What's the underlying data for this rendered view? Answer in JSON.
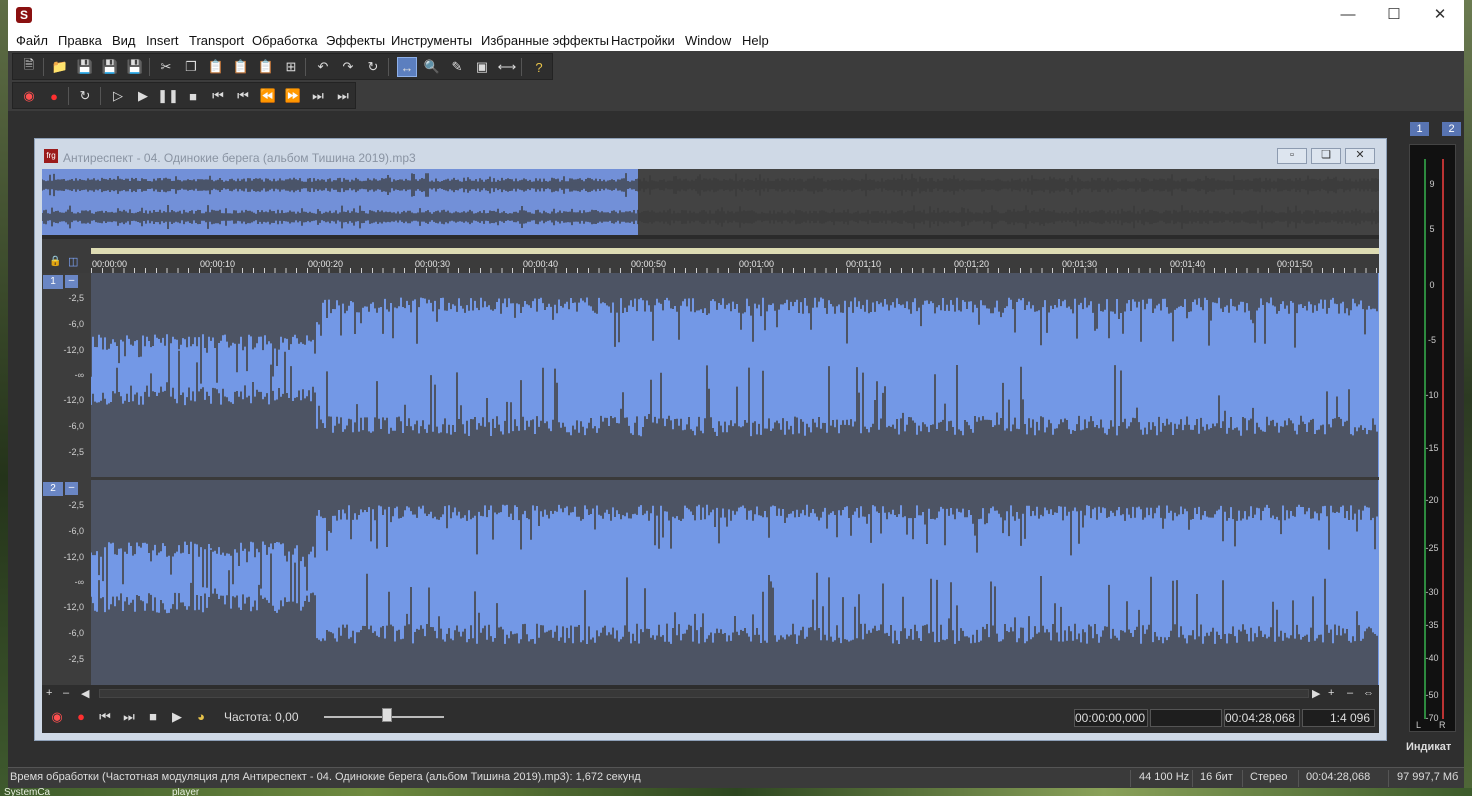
{
  "desktop": {
    "bottom_left": "SystemCa",
    "bottom_mid": "player"
  },
  "menu": [
    "Файл",
    "Правка",
    "Вид",
    "Insert",
    "Transport",
    "Обработка",
    "Эффекты",
    "Инструменты",
    "Избранные эффекты",
    "Настройки",
    "Window",
    "Help"
  ],
  "document": {
    "title": "Антиреспект - 04. Одинокие берега (альбом Тишина 2019).mp3",
    "icon_text": "frg"
  },
  "ruler": [
    "00:00:00",
    "00:00:10",
    "00:00:20",
    "00:00:30",
    "00:00:40",
    "00:00:50",
    "00:01:00",
    "00:01:10",
    "00:01:20",
    "00:01:30",
    "00:01:40",
    "00:01:50"
  ],
  "channels": [
    {
      "num": "1",
      "db": [
        "-2,5",
        "-6,0",
        "-12,0",
        "-∞",
        "-12,0",
        "-6,0",
        "-2,5"
      ]
    },
    {
      "num": "2",
      "db": [
        "-2,5",
        "-6,0",
        "-12,0",
        "-∞",
        "-12,0",
        "-6,0",
        "-2,5"
      ]
    }
  ],
  "transport": {
    "frequency": "Частота: 0,00",
    "position": "00:00:00,000",
    "selection": "",
    "length": "00:04:28,068",
    "zoom": "1:4 096"
  },
  "meter": {
    "tabs": [
      "1",
      "2"
    ],
    "scale": [
      "9",
      "5",
      "0",
      "-5",
      "-10",
      "-15",
      "-20",
      "-25",
      "-30",
      "-35",
      "-40",
      "-50",
      "-70"
    ],
    "channels": [
      "L",
      "R"
    ],
    "label": "Индикат"
  },
  "status": {
    "message": "Время обработки (Частотная модуляция для Антиреспект - 04. Одинокие берега (альбом Тишина 2019).mp3): 1,672 секунд",
    "sample_rate": "44 100 Hz",
    "bits": "16 бит",
    "channels": "Стерео",
    "length": "00:04:28,068",
    "free": "97 997,7 Мб"
  }
}
